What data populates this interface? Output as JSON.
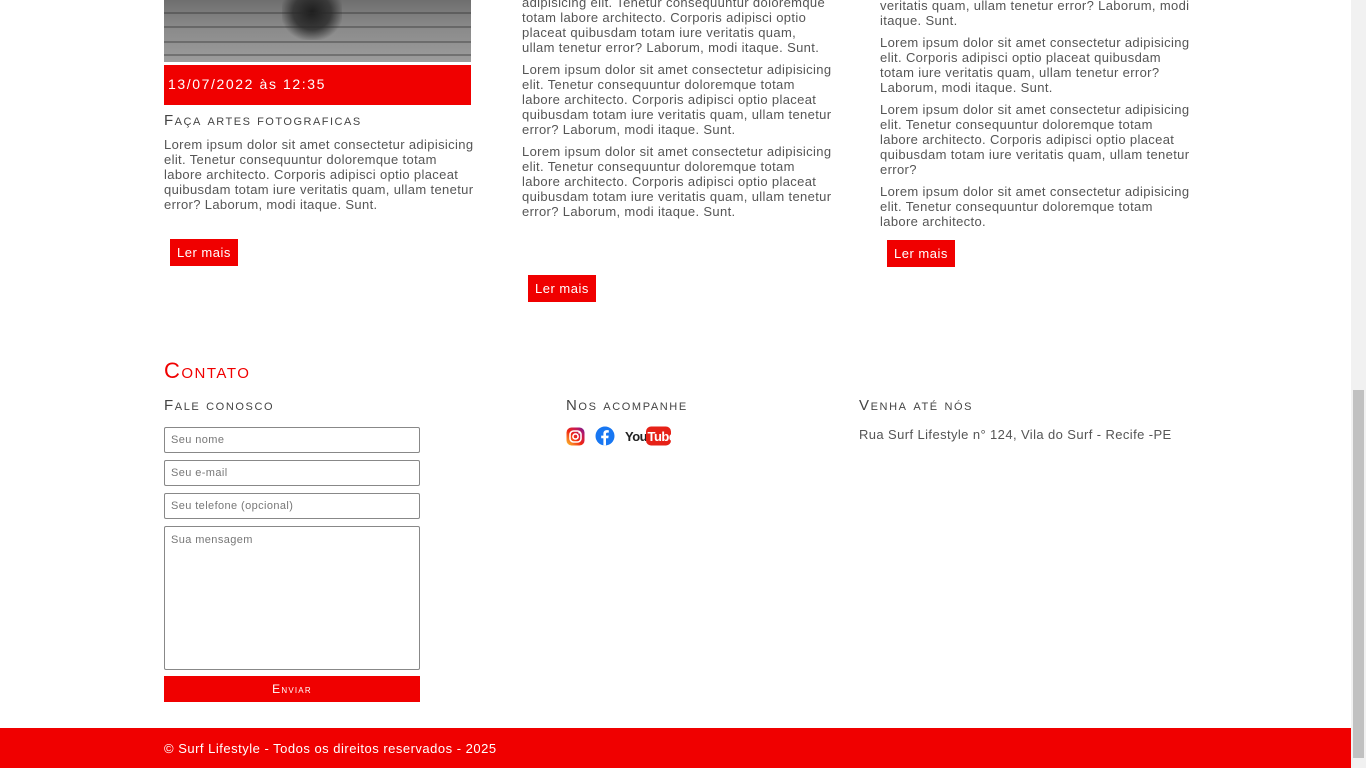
{
  "posts": [
    {
      "date": "13/07/2022 às 12:35",
      "title": "Faça artes fotograficas",
      "paragraphs": [
        "Lorem ipsum dolor sit amet consectetur adipisicing elit. Tenetur consequuntur doloremque totam labore architecto. Corporis adipisci optio placeat quibusdam totam iure veritatis quam, ullam tenetur error? Laborum, modi itaque. Sunt."
      ],
      "button": "Ler mais"
    },
    {
      "paragraphs": [
        "adipisicing elit. Tenetur consequuntur doloremque totam labore architecto. Corporis adipisci optio placeat quibusdam totam iure veritatis quam, ullam tenetur error? Laborum, modi itaque. Sunt.",
        "Lorem ipsum dolor sit amet consectetur adipisicing elit. Tenetur consequuntur doloremque totam labore architecto. Corporis adipisci optio placeat quibusdam totam iure veritatis quam, ullam tenetur error? Laborum, modi itaque. Sunt.",
        "Lorem ipsum dolor sit amet consectetur adipisicing elit. Tenetur consequuntur doloremque totam labore architecto. Corporis adipisci optio placeat quibusdam totam iure veritatis quam, ullam tenetur error? Laborum, modi itaque. Sunt."
      ],
      "button": "Ler mais"
    },
    {
      "paragraphs": [
        "veritatis quam, ullam tenetur error? Laborum, modi itaque. Sunt.",
        "Lorem ipsum dolor sit amet consectetur adipisicing elit. Corporis adipisci optio placeat quibusdam totam iure veritatis quam, ullam tenetur error? Laborum, modi itaque. Sunt.",
        "Lorem ipsum dolor sit amet consectetur adipisicing elit. Tenetur consequuntur doloremque totam labore architecto. Corporis adipisci optio placeat quibusdam totam iure veritatis quam, ullam tenetur error?",
        "Lorem ipsum dolor sit amet consectetur adipisicing elit. Tenetur consequuntur doloremque totam labore architecto."
      ],
      "button": "Ler mais"
    }
  ],
  "contact": {
    "title": "Contato",
    "form_title": "Fale conosco",
    "name_placeholder": "Seu nome",
    "email_placeholder": "Seu e-mail",
    "phone_placeholder": "Seu telefone (opcional)",
    "message_placeholder": "Sua mensagem",
    "send_label": "Enviar",
    "social_title": "Nos acompanhe",
    "social_icons": [
      "instagram-icon",
      "facebook-icon",
      "youtube-icon"
    ],
    "youtube_text": "YouTube",
    "address_title": "Venha até nós",
    "address": "Rua Surf Lifestyle n° 124, Vila do Surf - Recife -PE"
  },
  "footer": {
    "copyright": "© Surf Lifestyle - Todos os direitos reservados - 2025"
  },
  "colors": {
    "accent": "#f00000",
    "text": "#555555",
    "heading": "#444444"
  }
}
